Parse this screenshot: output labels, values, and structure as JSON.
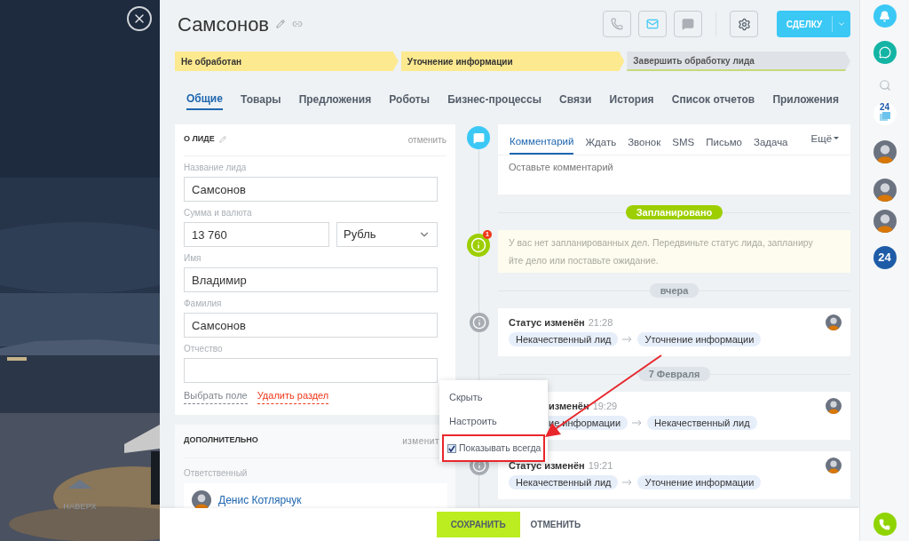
{
  "scroll_top": {
    "label": "НАВЕРХ"
  },
  "header": {
    "title": "Самсонов",
    "primary_button": "СДЕЛКУ"
  },
  "stages": [
    {
      "label": "Не обработан",
      "done": true
    },
    {
      "label": "Уточнение информации",
      "done": true
    },
    {
      "label": "Завершить обработку лида",
      "done": false
    }
  ],
  "tabs": [
    {
      "label": "Общие",
      "selected": true
    },
    {
      "label": "Товары",
      "selected": false
    },
    {
      "label": "Предложения",
      "selected": false
    },
    {
      "label": "Роботы",
      "selected": false
    },
    {
      "label": "Бизнес-процессы",
      "selected": false
    },
    {
      "label": "Связи",
      "selected": false
    },
    {
      "label": "История",
      "selected": false
    },
    {
      "label": "Список отчетов",
      "selected": false
    },
    {
      "label": "Приложения",
      "selected": false
    }
  ],
  "lead_card": {
    "title": "О ЛИДЕ",
    "action": "отменить",
    "fields": [
      {
        "kind": "text",
        "label": "Название лида",
        "value": "Самсонов"
      },
      {
        "kind": "money",
        "label": "Сумма и валюта",
        "value": "13 760",
        "currency": "Рубль"
      },
      {
        "kind": "text",
        "label": "Имя",
        "value": "Владимир"
      },
      {
        "kind": "text",
        "label": "Фамилия",
        "value": "Самсонов"
      },
      {
        "kind": "text",
        "label": "Отчество"
      }
    ],
    "links": [
      {
        "kind": "neutral",
        "label": "Выбрать поле"
      },
      {
        "kind": "danger",
        "label": "Удалить раздел"
      }
    ]
  },
  "extra_card": {
    "title": "ДОПОЛНИТЕЛЬНО",
    "action": "изменит",
    "field_label": "Ответственный",
    "person": "Денис Котлярчук"
  },
  "activity": {
    "tabs": [
      {
        "label": "Комментарий",
        "selected": true
      },
      {
        "label": "Ждать",
        "selected": false
      },
      {
        "label": "Звонок",
        "selected": false
      },
      {
        "label": "SMS",
        "selected": false
      },
      {
        "label": "Письмо",
        "selected": false
      },
      {
        "label": "Задача",
        "selected": false
      }
    ],
    "more": "Ещё",
    "placeholder": "Оставьте комментарий"
  },
  "timeline": [
    {
      "kind": "planned",
      "label": "Запланировано"
    },
    {
      "kind": "notice",
      "count": "1",
      "text": "У вас нет запланированных дел. Передвиньте статус лида, запланируйте дело или поставьте ожидание."
    },
    {
      "kind": "date",
      "label": "вчера"
    },
    {
      "kind": "status",
      "title": "Статус изменён",
      "time": "21:28",
      "from": "Некачественный лид",
      "to": "Уточнение информации"
    },
    {
      "kind": "date",
      "label": "7 Февраля"
    },
    {
      "kind": "status_covered",
      "title": "изменён",
      "time": "19:29",
      "from": "ие информации",
      "to": "Некачественный лид"
    },
    {
      "kind": "status",
      "title": "Статус изменён",
      "time": "19:21",
      "from": "Некачественный лид",
      "to": "Уточнение информации"
    }
  ],
  "context_menu": {
    "items": [
      {
        "kind": "plain",
        "label": "Скрыть"
      },
      {
        "kind": "plain",
        "label": "Настроить"
      },
      {
        "kind": "checkbox",
        "label": "Показывать всегда",
        "checked": true
      }
    ]
  },
  "footer": {
    "buttons": [
      {
        "kind": "primary",
        "label": "СОХРАНИТЬ"
      },
      {
        "kind": "link",
        "label": "ОТМЕНИТЬ"
      }
    ]
  },
  "right_bar": {
    "drive_label": "24",
    "app_label": "24"
  }
}
